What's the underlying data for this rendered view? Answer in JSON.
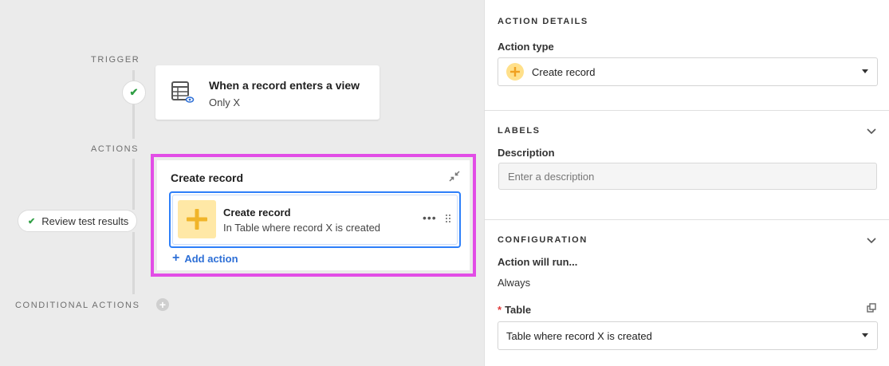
{
  "canvas": {
    "trigger_label": "TRIGGER",
    "actions_label": "ACTIONS",
    "conditional_actions_label": "CONDITIONAL ACTIONS",
    "trigger": {
      "title": "When a record enters a view",
      "subtitle": "Only X",
      "icon": "table-view-icon",
      "status_icon": "check-icon"
    },
    "review_button": {
      "label": "Review test results",
      "icon": "check-icon"
    },
    "action_group": {
      "title": "Create record",
      "collapse_icon": "collapse-arrows-icon",
      "action": {
        "icon": "plus-icon",
        "title": "Create record",
        "subtitle": "In Table where record X is created",
        "more_icon": "more-dots-icon",
        "drag_icon": "drag-handle-icon"
      },
      "add_action_label": "Add action"
    },
    "colors": {
      "highlight": "#e24de6",
      "selected": "#2d7ff9",
      "success": "#2f9e44",
      "accent_yellow": "#f0b429"
    }
  },
  "panel": {
    "action_details": {
      "heading": "ACTION DETAILS",
      "action_type_label": "Action type",
      "action_type_value": "Create record"
    },
    "labels": {
      "heading": "LABELS",
      "description_label": "Description",
      "description_placeholder": "Enter a description",
      "description_value": ""
    },
    "configuration": {
      "heading": "CONFIGURATION",
      "run_label": "Action will run...",
      "run_value": "Always",
      "table_label": "Table",
      "table_required_marker": "*",
      "table_value": "Table where record X is created"
    }
  }
}
